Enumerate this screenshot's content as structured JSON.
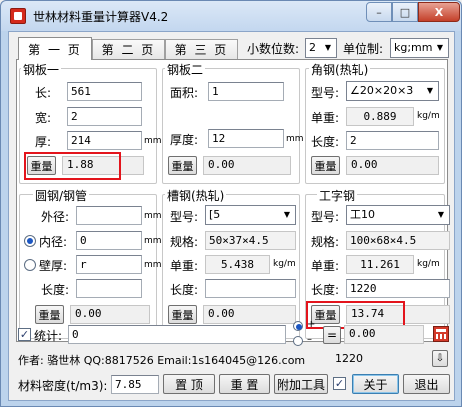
{
  "window": {
    "title": "世林材料重量计算器V4.2",
    "min_label": "–",
    "max_label": "□",
    "close_label": "X"
  },
  "tabs": [
    {
      "label": "第 一 页",
      "active": true
    },
    {
      "label": "第 二 页",
      "active": false
    },
    {
      "label": "第 三 页",
      "active": false
    }
  ],
  "settings": {
    "decimals_label": "小数位数:",
    "decimals_value": "2",
    "unit_label": "单位制:",
    "unit_value": "kg;mm"
  },
  "steel_plate_1": {
    "title": "钢板一",
    "length_label": "长:",
    "length_value": "561",
    "width_label": "宽:",
    "width_value": "2",
    "thickness_label": "厚:",
    "thickness_value": "214",
    "unit": "mm",
    "weight_button": "重量",
    "weight_value": "1.88"
  },
  "steel_plate_2": {
    "title": "钢板二",
    "area_label": "面积:",
    "area_value": "1",
    "thickness_label": "厚度:",
    "thickness_value": "12",
    "unit": "mm",
    "weight_button": "重量",
    "weight_value": "0.00"
  },
  "angle_steel": {
    "title": "角钢(热轧)",
    "model_label": "型号:",
    "model_value": "∠20×20×3",
    "unit_weight_label": "单重:",
    "unit_weight_value": "0.889",
    "unit_weight_unit": "kg/m",
    "length_label": "长度:",
    "length_value": "2",
    "weight_button": "重量",
    "weight_value": "0.00"
  },
  "round_pipe": {
    "title": "圆钢/钢管",
    "outer_label": "外径:",
    "outer_value": "",
    "inner_label": "内径:",
    "inner_value": "0",
    "inner_selected": true,
    "wall_label": "壁厚:",
    "wall_value": "r",
    "wall_selected": false,
    "length_label": "长度:",
    "length_value": "",
    "unit": "mm",
    "weight_button": "重量",
    "weight_value": "0.00"
  },
  "channel_steel": {
    "title": "槽钢(热轧)",
    "model_label": "型号:",
    "model_value": "[5",
    "spec_label": "规格:",
    "spec_value": "50×37×4.5",
    "unit_weight_label": "单重:",
    "unit_weight_value": "5.438",
    "unit_weight_unit": "kg/m",
    "length_label": "长度:",
    "length_value": "",
    "weight_button": "重量",
    "weight_value": "0.00"
  },
  "i_beam": {
    "title": "工字钢",
    "model_label": "型号:",
    "model_value": "工10",
    "spec_label": "规格:",
    "spec_value": "100×68×4.5",
    "unit_weight_label": "单重:",
    "unit_weight_value": "11.261",
    "unit_weight_unit": "kg/m",
    "length_label": "长度:",
    "length_value": "1220",
    "weight_button": "重量",
    "weight_value": "13.74"
  },
  "stats": {
    "label": "统计:",
    "checked": true,
    "value": "0",
    "plus_label": "+",
    "minus_label": "–",
    "equals_label": "=",
    "result_value": "0.00"
  },
  "footer": {
    "author": "作者: 骆世林 QQ:8817526  Email:1s164045@126.com",
    "status_value": "1220",
    "density_label": "材料密度(t/m3):",
    "density_value": "7.85",
    "top_button": "置 顶",
    "reset_button": "重 置",
    "addon_button": "附加工具",
    "addon_checked": true,
    "about_button": "关于",
    "exit_button": "退出"
  }
}
